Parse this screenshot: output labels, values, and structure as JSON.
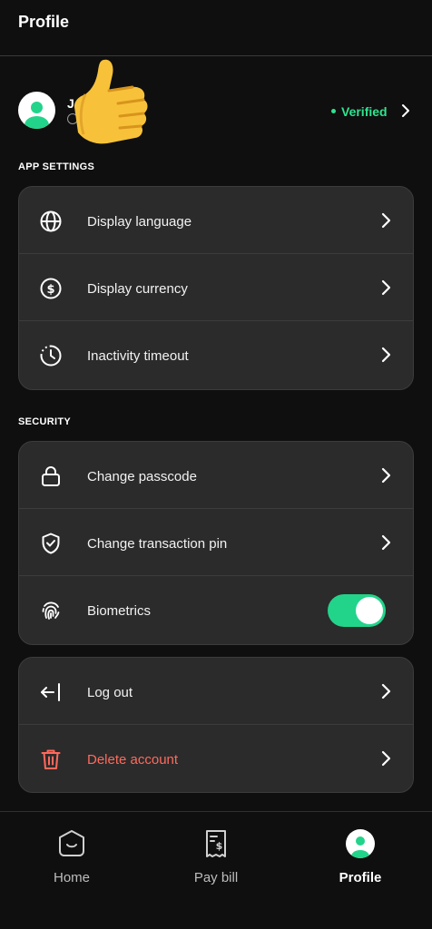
{
  "header": {
    "title": "Profile"
  },
  "profile": {
    "name": "Joe",
    "verified_label": "Verified",
    "accent": "#2fe38f"
  },
  "sections": {
    "app_settings": {
      "label": "APP SETTINGS",
      "items": [
        {
          "label": "Display language",
          "icon": "globe-icon"
        },
        {
          "label": "Display currency",
          "icon": "dollar-circle-icon"
        },
        {
          "label": "Inactivity timeout",
          "icon": "clock-timeout-icon"
        }
      ]
    },
    "security": {
      "label": "SECURITY",
      "items": [
        {
          "label": "Change passcode",
          "icon": "lock-icon"
        },
        {
          "label": "Change transaction pin",
          "icon": "shield-check-icon"
        },
        {
          "label": "Biometrics",
          "icon": "fingerprint-icon",
          "toggle_on": true
        }
      ]
    },
    "account": {
      "items": [
        {
          "label": "Log out",
          "icon": "logout-icon"
        },
        {
          "label": "Delete account",
          "icon": "trash-icon",
          "color": "#ff6a5c"
        }
      ]
    }
  },
  "bottom_nav": {
    "items": [
      {
        "label": "Home",
        "icon": "home-icon"
      },
      {
        "label": "Pay bill",
        "icon": "receipt-icon"
      },
      {
        "label": "Profile",
        "icon": "profile-avatar-icon",
        "active": true
      }
    ]
  },
  "colors": {
    "background": "#0f0f0f",
    "card": "#2b2b2b",
    "toggle_on": "#22d48a",
    "danger": "#ff6a5c"
  }
}
